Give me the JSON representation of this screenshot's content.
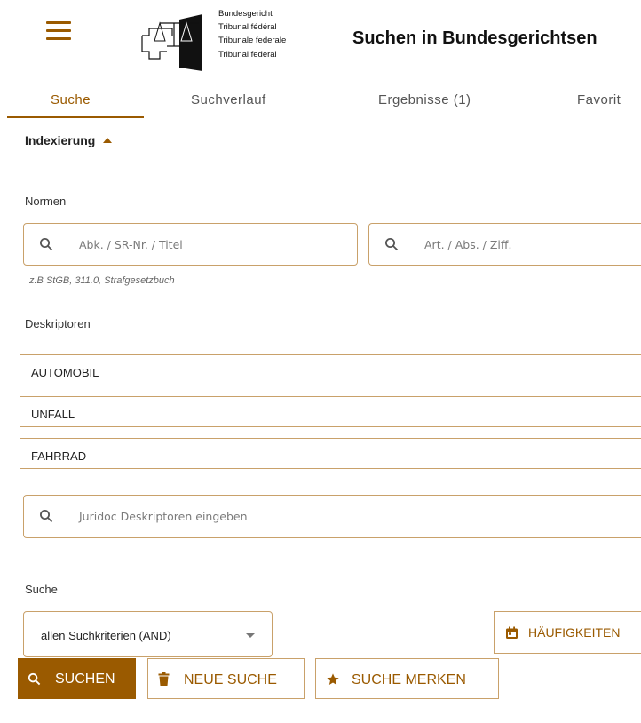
{
  "header": {
    "logo_lines": [
      "Bundesgericht",
      "Tribunal fédéral",
      "Tribunale federale",
      "Tribunal federal"
    ],
    "title": "Suchen in Bundesgerichtsen"
  },
  "tabs": [
    {
      "label": "Suche",
      "active": true
    },
    {
      "label": "Suchverlauf",
      "active": false
    },
    {
      "label": "Ergebnisse (1)",
      "active": false
    },
    {
      "label": "Favorit",
      "active": false
    }
  ],
  "indexing": {
    "label": "Indexierung"
  },
  "normen": {
    "label": "Normen",
    "field1_placeholder": "Abk. / SR-Nr. / Titel",
    "field2_placeholder": "Art. / Abs. / Ziff.",
    "hint": "z.B StGB, 311.0, Strafgesetzbuch"
  },
  "deskriptoren": {
    "label": "Deskriptoren",
    "items": [
      "AUTOMOBIL",
      "UNFALL",
      "FAHRRAD"
    ],
    "input_placeholder": "Juridoc Deskriptoren eingeben"
  },
  "suche": {
    "label": "Suche",
    "mode_value": "allen Suchkriterien (AND)",
    "frequency_label": "HÄUFIGKEITEN"
  },
  "actions": {
    "search": "SUCHEN",
    "new_search": "NEUE SUCHE",
    "save_search": "SUCHE MERKEN"
  },
  "colors": {
    "accent": "#9a5a00",
    "border": "#c9a16a"
  }
}
